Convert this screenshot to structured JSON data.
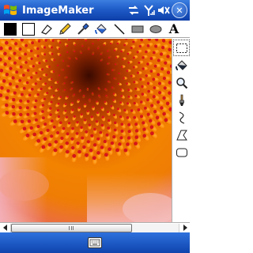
{
  "app": {
    "title": "ImageMaker"
  },
  "colors": {
    "titlebar": "#1f5cc8",
    "foreground_color": "#000000",
    "background_color": "#ffffff",
    "menubar": "#0f44ad"
  },
  "tray": {
    "icons": [
      "connectivity-icon",
      "signal-icon",
      "volume-icon"
    ],
    "close_label": "ok-close"
  },
  "toolbar": {
    "tools": [
      "foreground-color-swatch",
      "background-color-swatch",
      "eraser-tool",
      "pencil-tool",
      "eyedropper-tool",
      "fill-bucket-tool",
      "line-tool",
      "rectangle-tool",
      "ellipse-tool"
    ],
    "text_tool_label": "A"
  },
  "sidepanel": {
    "tools": [
      "select-tool",
      "fill-tool",
      "zoom-tool",
      "brush-tool",
      "curve-tool",
      "polygon-tool",
      "rounded-rect-tool"
    ],
    "selected": "select-tool"
  },
  "scrollbar": {
    "position_fraction": 0.0,
    "visible_fraction": 0.72
  },
  "menubar": {
    "icon": "keyboard-icon"
  }
}
